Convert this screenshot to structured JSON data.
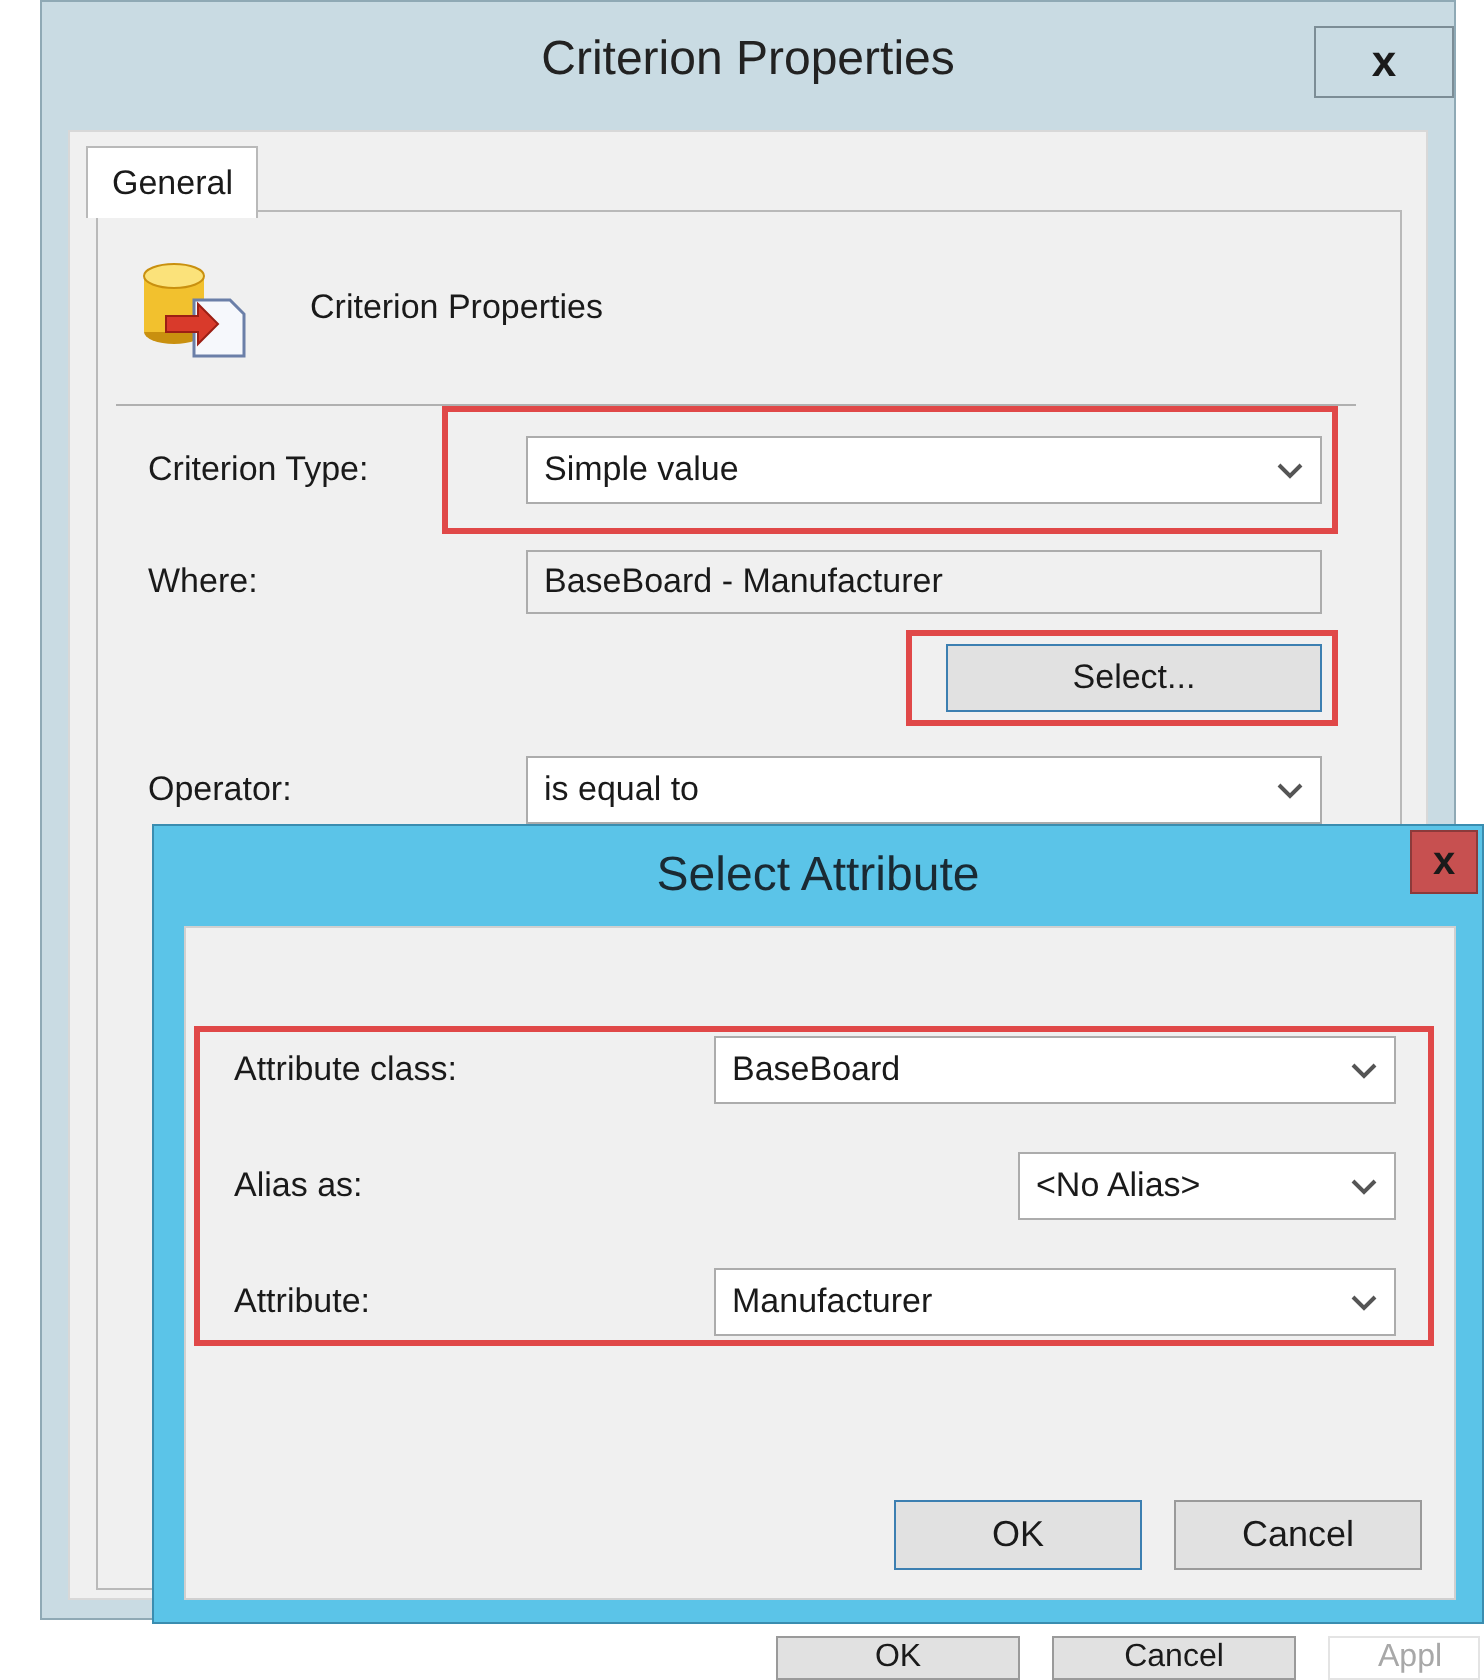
{
  "criterion_window": {
    "title": "Criterion Properties",
    "close_label": "x",
    "tabs": [
      {
        "label": "General",
        "selected": true
      }
    ],
    "header": "Criterion Properties",
    "fields": [
      {
        "kind": "dropdown",
        "label": "Criterion Type:",
        "value": "Simple value",
        "highlighted": true
      },
      {
        "kind": "readonly",
        "label": "Where:",
        "value": "BaseBoard - Manufacturer",
        "highlighted": false
      },
      {
        "kind": "button",
        "value": "Select...",
        "highlighted": true
      },
      {
        "kind": "dropdown",
        "label": "Operator:",
        "value": "is equal to",
        "highlighted": false
      }
    ]
  },
  "background_buttons": [
    {
      "label": "OK",
      "disabled": false
    },
    {
      "label": "Cancel",
      "disabled": false
    },
    {
      "label": "Appl",
      "disabled": true
    }
  ],
  "select_attribute_dialog": {
    "title": "Select Attribute",
    "close_label": "x",
    "group_highlighted": true,
    "fields": [
      {
        "label": "Attribute class:",
        "value": "BaseBoard"
      },
      {
        "label": "Alias as:",
        "value": "<No Alias>"
      },
      {
        "label": "Attribute:",
        "value": "Manufacturer"
      }
    ],
    "buttons": [
      {
        "label": "OK",
        "default": true
      },
      {
        "label": "Cancel",
        "default": false
      }
    ]
  }
}
